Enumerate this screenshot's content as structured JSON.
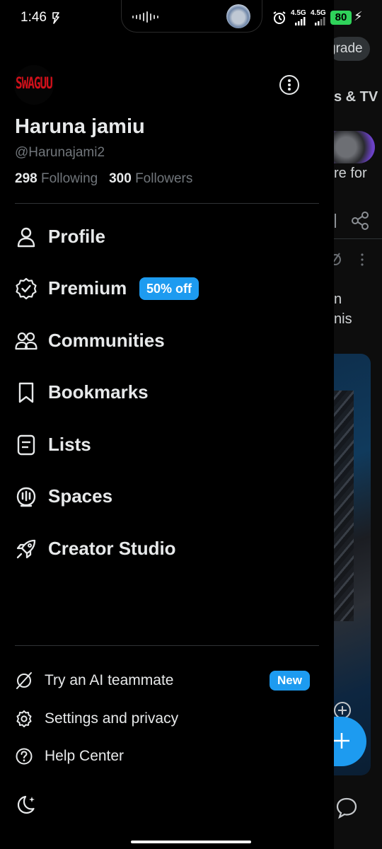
{
  "status_bar": {
    "time": "1:46",
    "network_1": "4.5G",
    "network_2": "4.5G",
    "battery": "80"
  },
  "profile": {
    "logo_text": "SWAGUU",
    "display_name": "Haruna jamiu",
    "handle": "@Harunajami2",
    "following_count": "298",
    "following_label": "Following",
    "followers_count": "300",
    "followers_label": "Followers"
  },
  "menu": {
    "items": [
      {
        "label": "Profile",
        "icon": "person-icon"
      },
      {
        "label": "Premium",
        "icon": "verified-badge-icon",
        "badge": "50% off"
      },
      {
        "label": "Communities",
        "icon": "people-icon"
      },
      {
        "label": "Bookmarks",
        "icon": "bookmark-icon"
      },
      {
        "label": "Lists",
        "icon": "list-icon"
      },
      {
        "label": "Spaces",
        "icon": "microphone-icon"
      },
      {
        "label": "Creator Studio",
        "icon": "rocket-icon"
      }
    ]
  },
  "secondary": {
    "items": [
      {
        "label": "Try an AI teammate",
        "icon": "ai-slash-icon",
        "badge": "New"
      },
      {
        "label": "Settings and privacy",
        "icon": "gear-icon"
      },
      {
        "label": "Help Center",
        "icon": "help-icon"
      }
    ]
  },
  "background": {
    "pill_text": "grade",
    "tab_text": "s & TV",
    "snippet_1": "re  for",
    "snippet_2": "n",
    "snippet_3": "nis"
  },
  "colors": {
    "accent": "#1d9bf0",
    "background": "#000000",
    "text_primary": "#e7e9ea",
    "text_secondary": "#71767b",
    "logo_red": "#d0101a"
  }
}
